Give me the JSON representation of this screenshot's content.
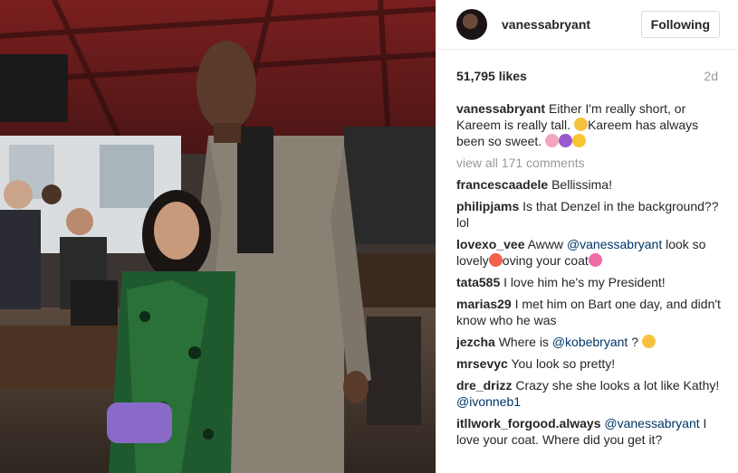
{
  "post": {
    "username": "vanessabryant",
    "follow_label": "Following",
    "likes": "51,795 likes",
    "age": "2d",
    "view_all": "view all 171 comments"
  },
  "caption": {
    "user": "vanessabryant",
    "text_1": "Either I'm really short, or Kareem is really tall. ",
    "text_2": "Kareem has always been so sweet. "
  },
  "comments": [
    {
      "user": "francescaadele",
      "text": "Bellissima!"
    },
    {
      "user": "philipjams",
      "text": "Is that Denzel in the background?? lol"
    },
    {
      "user": "lovexo_vee",
      "pre": "Awww ",
      "mention": "@vanessabryant",
      "post": " look so lovely",
      "post2": "oving your coat"
    },
    {
      "user": "tata585",
      "text": "I love him he's my President!"
    },
    {
      "user": "marias29",
      "text": "I met him on Bart one day, and didn't know who he was"
    },
    {
      "user": "jezcha",
      "pre": "Where is ",
      "mention": "@kobebryant",
      "post": " ? "
    },
    {
      "user": "mrsevyc",
      "text": "You look so pretty!"
    },
    {
      "user": "dre_drizz",
      "pre": "Crazy she she looks a lot like Kathy! ",
      "mention": "@ivonneb1"
    },
    {
      "user": "itllwork_forgood.always",
      "mention": "@vanessabryant",
      "post": " I love your coat. Where did you get it?"
    }
  ],
  "icons": [
    "profile-avatar-icon",
    "smile-emoji-icon",
    "party-emoji-icon",
    "purple-heart-emoji-icon",
    "yellow-heart-emoji-icon",
    "heart-eyes-emoji-icon",
    "pink-hearts-emoji-icon",
    "wink-emoji-icon"
  ]
}
